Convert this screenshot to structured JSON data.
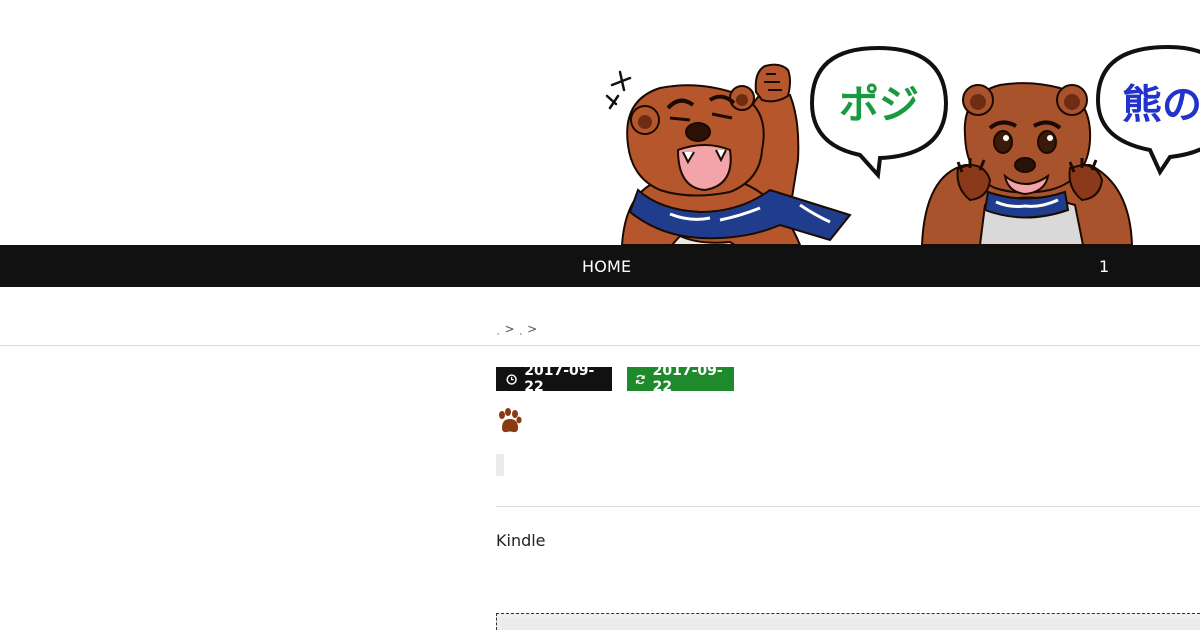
{
  "header": {
    "bubble_1_text": "ポジ",
    "bubble_2_text": "熊の"
  },
  "nav": {
    "home_label": "HOME",
    "item_2_label": "1"
  },
  "breadcrumb": {
    "sep_1": ">",
    "sep_2": ">"
  },
  "post": {
    "published_date": "2017-09-22",
    "updated_date": "2017-09-22",
    "body_text": "Kindle"
  },
  "colors": {
    "nav_bg": "#111111",
    "updated_badge": "#1f8a2b",
    "paw": "#8a3a12",
    "bubble_1_text": "#1a9a40",
    "bubble_2_text": "#2233cc"
  }
}
